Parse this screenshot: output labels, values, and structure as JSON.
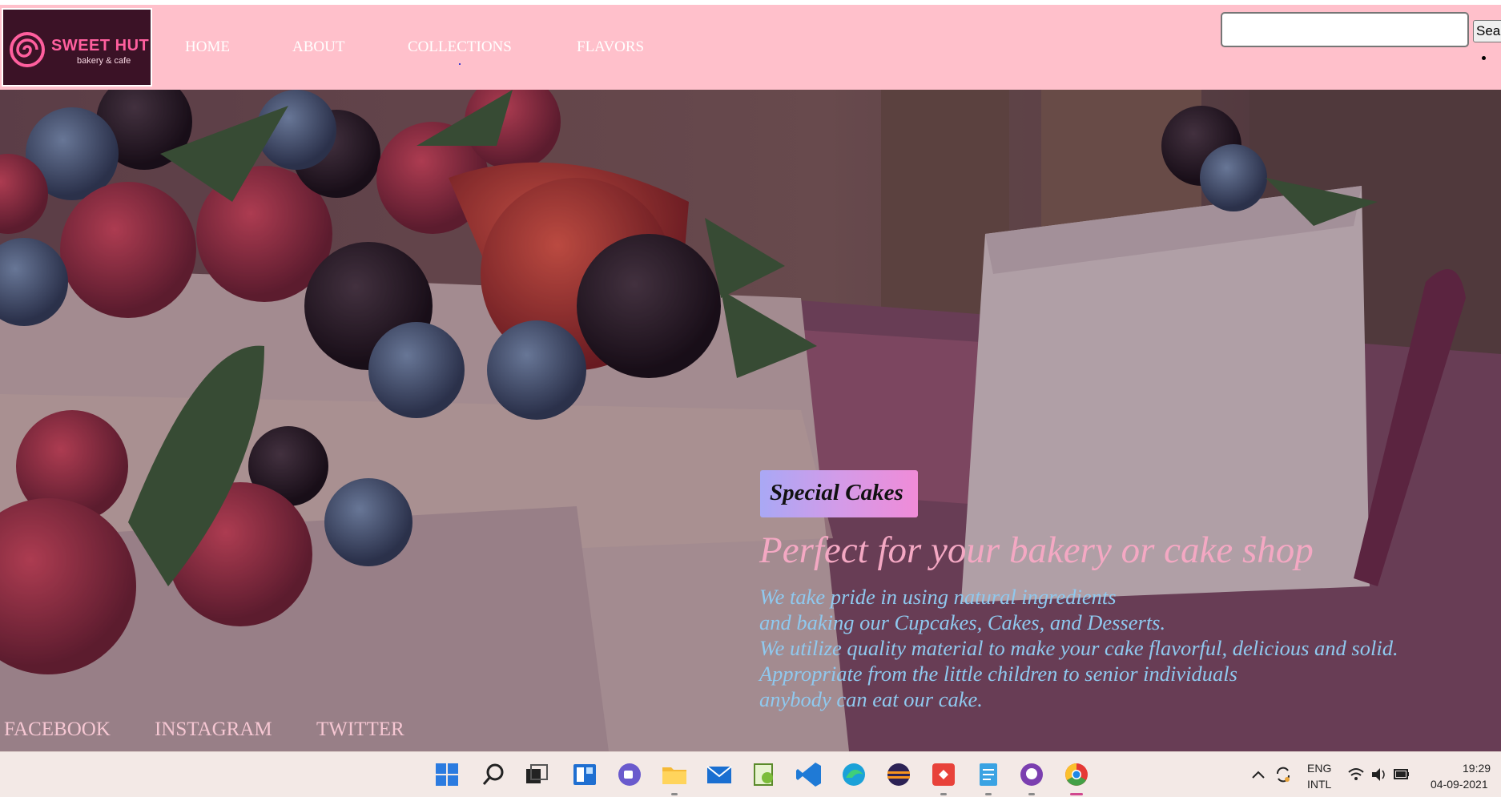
{
  "brand": {
    "name": "SWEET HUT",
    "tagline": "bakery & cafe"
  },
  "nav": {
    "items": [
      "HOME",
      "ABOUT",
      "COLLECTIONS",
      "FLAVORS"
    ]
  },
  "search": {
    "placeholder": "",
    "button_label": "Search"
  },
  "hero": {
    "badge": "Special Cakes",
    "headline": "Perfect for your bakery or cake shop",
    "lines": [
      "We take pride in using natural ingredients",
      "and baking our Cupcakes, Cakes, and Desserts.",
      "We utilize quality material to make your cake flavorful, delicious and solid.",
      "Appropriate from the little children to senior individuals",
      "anybody can eat our cake."
    ]
  },
  "social": {
    "items": [
      "FACEBOOK",
      "INSTAGRAM",
      "TWITTER"
    ]
  },
  "taskbar": {
    "apps": [
      "windows-start",
      "search",
      "task-view",
      "widgets",
      "chat",
      "file-explorer",
      "mail",
      "notepad-plus",
      "vscode",
      "edge",
      "eclipse",
      "git-app",
      "notepad",
      "github",
      "chrome"
    ],
    "lang_top": "ENG",
    "lang_bottom": "INTL",
    "time": "19:29",
    "date": "04-09-2021"
  },
  "colors": {
    "header_bg": "#ffc0cb",
    "logo_bg": "#3b1226",
    "brand_pink": "#ff5f9e",
    "headline": "#f4a8c3",
    "description": "#8fc9ef",
    "badge_from": "#a9a8f5",
    "badge_to": "#f08bd8"
  }
}
